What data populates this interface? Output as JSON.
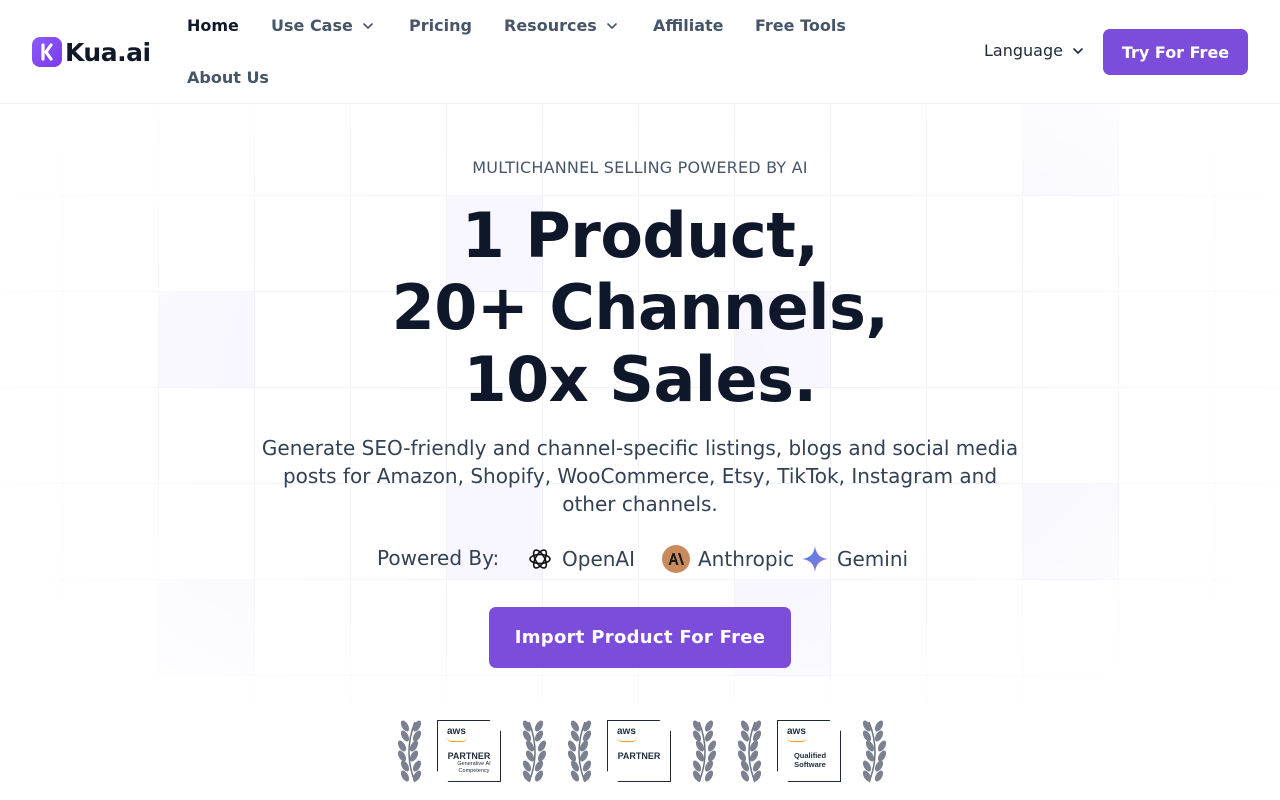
{
  "header": {
    "logo_text": "Kua.ai",
    "nav": [
      {
        "label": "Home",
        "active": true,
        "dropdown": false
      },
      {
        "label": "Use Case",
        "active": false,
        "dropdown": true
      },
      {
        "label": "Pricing",
        "active": false,
        "dropdown": false
      },
      {
        "label": "Resources",
        "active": false,
        "dropdown": true
      },
      {
        "label": "Affiliate",
        "active": false,
        "dropdown": false
      },
      {
        "label": "Free Tools",
        "active": false,
        "dropdown": false
      },
      {
        "label": "About Us",
        "active": false,
        "dropdown": false
      }
    ],
    "language_label": "Language",
    "cta_label": "Try For Free"
  },
  "hero": {
    "eyebrow": "MULTICHANNEL SELLING POWERED BY AI",
    "headline_lines": [
      "1 Product,",
      "20+ Channels,",
      "10x Sales."
    ],
    "subtitle": "Generate SEO-friendly and channel-specific listings, blogs and social media posts for Amazon, Shopify, WooCommerce, Etsy, TikTok, Instagram and other channels.",
    "powered_by_label": "Powered By:",
    "providers": [
      {
        "name": "OpenAI",
        "icon": "openai-icon"
      },
      {
        "name": "Anthropic",
        "icon": "anthropic-icon"
      },
      {
        "name": "Gemini",
        "icon": "gemini-icon"
      }
    ],
    "cta_label": "Import Product For Free"
  },
  "badges": [
    {
      "brand": "aws",
      "title": "PARTNER",
      "subtitle": "Generative AI Competency"
    },
    {
      "brand": "aws",
      "title": "PARTNER",
      "subtitle": ""
    },
    {
      "brand": "aws",
      "title": "Qualified Software",
      "subtitle": ""
    }
  ],
  "colors": {
    "accent": "#7c4ddb",
    "text_dark": "#0f172a",
    "text_muted": "#475569",
    "anthropic_bg": "#c98a5e",
    "gemini_blue": "#4285f4"
  }
}
